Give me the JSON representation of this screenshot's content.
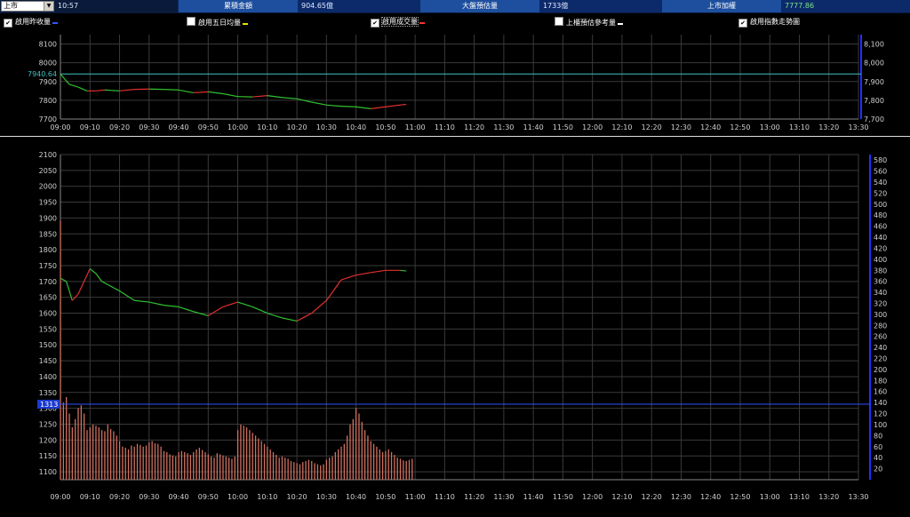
{
  "header": {
    "market_select": "上市",
    "time": "10:57",
    "cum_amount_label": "累積金額",
    "cum_amount_value": "904.65億",
    "est_volume_label": "大盤預估量",
    "est_volume_value": "1733億",
    "index_label": "上市加權",
    "index_value": "7777.86"
  },
  "options": [
    {
      "label": "啟用昨收量",
      "checked": true,
      "swatch": "#3355ff"
    },
    {
      "label": "啟用五日均量",
      "checked": false,
      "swatch": "#e8e000"
    },
    {
      "label": "啟用成交量",
      "checked": true,
      "swatch": "#ff3030"
    },
    {
      "label": "上櫃預估參考量",
      "checked": false,
      "swatch": "#ffffff"
    },
    {
      "label": "啟用指數走勢圖",
      "checked": true,
      "swatch": ""
    }
  ],
  "colors": {
    "up": "#e03030",
    "down": "#30c030",
    "ref_line": "#40c0c0",
    "volume": "#d07060",
    "ref_volume": "#3050ff"
  },
  "chart_data": [
    {
      "type": "line",
      "title": "",
      "x_ticks": [
        "09:00",
        "09:10",
        "09:20",
        "09:30",
        "09:40",
        "09:50",
        "10:00",
        "10:10",
        "10:20",
        "10:30",
        "10:40",
        "10:50",
        "11:00",
        "11:10",
        "11:20",
        "11:30",
        "11:40",
        "11:50",
        "12:00",
        "12:10",
        "12:20",
        "12:30",
        "12:40",
        "12:50",
        "13:00",
        "13:10",
        "13:20",
        "13:30"
      ],
      "y_ticks_left": [
        "8100",
        "8000",
        "7900",
        "7800",
        "7700"
      ],
      "y_ticks_right": [
        "8,100",
        "8,000",
        "7,900",
        "7,800",
        "7,700"
      ],
      "ylim": [
        7700,
        8150
      ],
      "reference_value": 7940.64,
      "reference_label": "7940.64",
      "x": [
        0,
        3,
        6,
        9,
        12,
        15,
        20,
        25,
        30,
        35,
        40,
        45,
        50,
        55,
        60,
        65,
        70,
        75,
        80,
        85,
        90,
        95,
        100,
        105,
        110,
        115,
        117
      ],
      "values": [
        7940,
        7885,
        7870,
        7850,
        7850,
        7855,
        7850,
        7858,
        7860,
        7858,
        7855,
        7840,
        7845,
        7835,
        7820,
        7818,
        7825,
        7815,
        7808,
        7790,
        7775,
        7768,
        7765,
        7755,
        7765,
        7775,
        7778
      ]
    },
    {
      "type": "bar",
      "title": "",
      "x_ticks": [
        "09:00",
        "09:10",
        "09:20",
        "09:30",
        "09:40",
        "09:50",
        "10:00",
        "10:10",
        "10:20",
        "10:30",
        "10:40",
        "10:50",
        "11:00",
        "11:10",
        "11:20",
        "11:30",
        "11:40",
        "11:50",
        "12:00",
        "12:10",
        "12:20",
        "12:30",
        "12:40",
        "12:50",
        "13:00",
        "13:10",
        "13:20",
        "13:30"
      ],
      "y_ticks_left": [
        "2100",
        "2050",
        "2000",
        "1950",
        "1900",
        "1850",
        "1800",
        "1750",
        "1700",
        "1650",
        "1600",
        "1550",
        "1500",
        "1450",
        "1400",
        "1350",
        "1300",
        "1250",
        "1200",
        "1150",
        "1100"
      ],
      "y_ticks_right": [
        "580",
        "560",
        "540",
        "520",
        "500",
        "480",
        "460",
        "440",
        "420",
        "400",
        "380",
        "360",
        "340",
        "320",
        "300",
        "280",
        "260",
        "240",
        "220",
        "200",
        "180",
        "160",
        "140",
        "120",
        "100",
        "80",
        "60",
        "40",
        "20"
      ],
      "ylim_left": [
        1075,
        2100
      ],
      "ylim_right": [
        0,
        590
      ],
      "ref_volume_label": "1313",
      "ref_volume_value": 1313,
      "line_x": [
        0,
        2,
        4,
        6,
        8,
        10,
        12,
        14,
        16,
        20,
        25,
        30,
        35,
        40,
        45,
        50,
        55,
        60,
        65,
        70,
        75,
        80,
        85,
        90,
        95,
        100,
        105,
        110,
        115,
        117
      ],
      "line_values": [
        1710,
        1700,
        1640,
        1660,
        1700,
        1740,
        1725,
        1700,
        1690,
        1670,
        1640,
        1635,
        1625,
        1620,
        1605,
        1592,
        1620,
        1635,
        1620,
        1600,
        1585,
        1575,
        1600,
        1640,
        1705,
        1720,
        1728,
        1735,
        1735,
        1733
      ],
      "volume_values": [
        470,
        140,
        150,
        120,
        95,
        110,
        130,
        135,
        120,
        90,
        95,
        100,
        98,
        95,
        90,
        88,
        100,
        92,
        88,
        80,
        70,
        60,
        58,
        55,
        62,
        60,
        65,
        63,
        60,
        62,
        68,
        70,
        66,
        65,
        60,
        52,
        50,
        46,
        44,
        42,
        50,
        52,
        50,
        48,
        45,
        50,
        55,
        58,
        54,
        50,
        46,
        42,
        40,
        48,
        46,
        44,
        42,
        40,
        38,
        42,
        90,
        100,
        98,
        95,
        90,
        85,
        80,
        75,
        70,
        65,
        60,
        55,
        50,
        45,
        40,
        42,
        40,
        38,
        34,
        32,
        30,
        28,
        32,
        34,
        36,
        34,
        30,
        28,
        26,
        28,
        36,
        40,
        42,
        50,
        55,
        60,
        65,
        80,
        100,
        110,
        130,
        120,
        105,
        90,
        80,
        70,
        65,
        60,
        55,
        50,
        52,
        55,
        50,
        45,
        40,
        38,
        35,
        34,
        36,
        38
      ]
    }
  ]
}
